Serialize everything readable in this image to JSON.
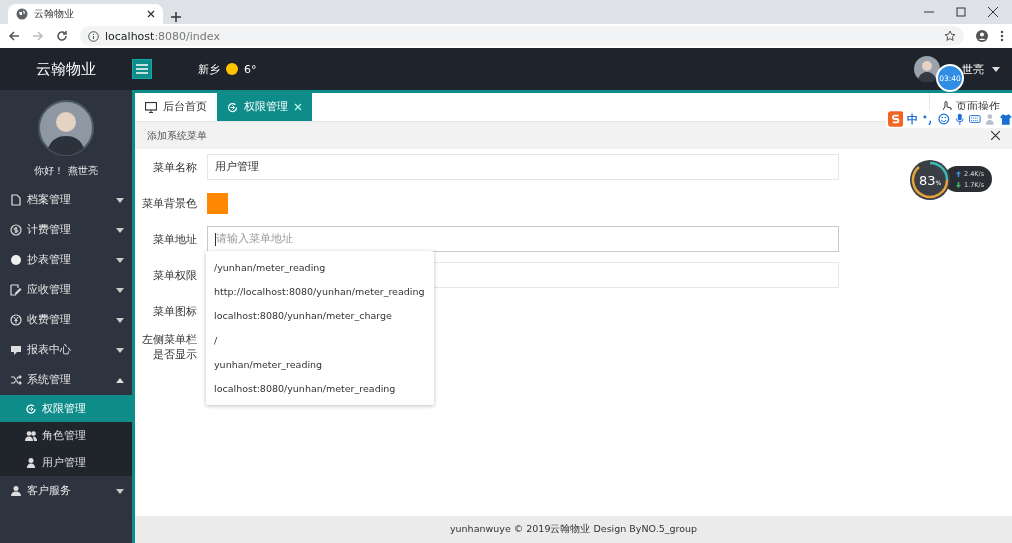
{
  "browser": {
    "tab_title": "云翰物业",
    "url_host": "localhost",
    "url_path": ":8080/index"
  },
  "header": {
    "brand": "云翰物业",
    "city": "新乡",
    "temperature": "6°",
    "user_name": "世亮"
  },
  "sidebar": {
    "greeting": "你好！ 燕世亮",
    "items": [
      {
        "label": "档案管理",
        "expanded": false
      },
      {
        "label": "计费管理",
        "expanded": false
      },
      {
        "label": "抄表管理",
        "expanded": false
      },
      {
        "label": "应收管理",
        "expanded": false
      },
      {
        "label": "收费管理",
        "expanded": false
      },
      {
        "label": "报表中心",
        "expanded": false
      },
      {
        "label": "系统管理",
        "expanded": true,
        "children": [
          {
            "label": "权限管理",
            "selected": true
          },
          {
            "label": "角色管理",
            "selected": false
          },
          {
            "label": "用户管理",
            "selected": false
          }
        ]
      },
      {
        "label": "客户服务",
        "expanded": false
      }
    ]
  },
  "tabs": [
    {
      "label": "后台首页",
      "selected": false,
      "closable": false
    },
    {
      "label": "权限管理",
      "selected": true,
      "closable": true
    }
  ],
  "page_action": "页面操作",
  "panel": {
    "title": "添加系统菜单",
    "fields": [
      {
        "label": "菜单名称",
        "kind": "text",
        "value": "用户管理"
      },
      {
        "label": "菜单背景色",
        "kind": "color",
        "color": "#ff8800"
      },
      {
        "label": "菜单地址",
        "kind": "text",
        "placeholder": "请输入菜单地址"
      },
      {
        "label": "菜单权限",
        "kind": "text"
      },
      {
        "label": "菜单图标",
        "kind": "none"
      },
      {
        "label": "左侧菜单栏是否显示",
        "kind": "none"
      }
    ],
    "suggestions": [
      "/yunhan/meter_reading",
      "http://localhost:8080/yunhan/meter_reading",
      "localhost:8080/yunhan/meter_charge",
      "/",
      "yunhan/meter_reading",
      "localhost:8080/yunhan/meter_reading"
    ]
  },
  "footer": "yunhanwuye © 2019云翰物业 Design ByNO.5_group",
  "overlays": {
    "timer": "03:40",
    "ime_mode": "中",
    "meter": "83",
    "meter_unit": "%",
    "upload": "2.4",
    "upload_unit": "K/s",
    "download": "1.7",
    "download_unit": "K/s"
  }
}
